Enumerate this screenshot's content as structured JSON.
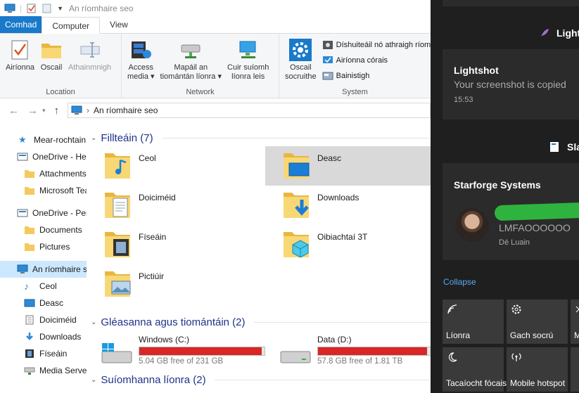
{
  "explorer": {
    "title": "An ríomhaire seo",
    "tabs": {
      "file": "Comhad",
      "computer": "Computer",
      "view": "View"
    },
    "ribbon": {
      "location": {
        "label": "Location",
        "properties": "Airíonna",
        "open": "Oscail",
        "rename": "Athainmnigh"
      },
      "network": {
        "label": "Network",
        "access_media_1": "Access",
        "access_media_2": "media",
        "map_drive_1": "Mapáil an",
        "map_drive_2": "tiomántán líonra",
        "add_location_1": "Cuir suíomh",
        "add_location_2": "líonra leis"
      },
      "system": {
        "label": "System",
        "open_settings_1": "Oscail",
        "open_settings_2": "socruithe",
        "uninstall": "Díshuiteáil nó athraigh ríomhchláir",
        "system_properties": "Airíonna córais",
        "manage": "Bainistigh"
      }
    },
    "address": {
      "path": "An ríomhaire seo"
    },
    "nav": [
      {
        "label": "Mear-rochtain",
        "icon": "star-icon"
      },
      {
        "label": "OneDrive - Heartbeat",
        "icon": "onedrive-icon"
      },
      {
        "label": "Attachments",
        "icon": "folder-icon"
      },
      {
        "label": "Microsoft Teams",
        "icon": "folder-icon"
      },
      {
        "label": "OneDrive - Personal",
        "icon": "onedrive-icon"
      },
      {
        "label": "Documents",
        "icon": "folder-icon"
      },
      {
        "label": "Pictures",
        "icon": "folder-icon"
      },
      {
        "label": "An ríomhaire seo",
        "icon": "computer-icon"
      },
      {
        "label": "Ceol",
        "icon": "music-icon"
      },
      {
        "label": "Deasc",
        "icon": "desktop-icon"
      },
      {
        "label": "Doiciméid",
        "icon": "document-icon"
      },
      {
        "label": "Downloads",
        "icon": "download-icon"
      },
      {
        "label": "Físeáin",
        "icon": "video-icon"
      },
      {
        "label": "Media Server",
        "icon": "network-drive-icon"
      }
    ],
    "folders_header": "Fillteáin (7)",
    "folders": [
      {
        "label": "Ceol",
        "icon": "music"
      },
      {
        "label": "Deasc",
        "icon": "desktop"
      },
      {
        "label": "Doiciméid",
        "icon": "document"
      },
      {
        "label": "Downloads",
        "icon": "download"
      },
      {
        "label": "Físeáin",
        "icon": "video"
      },
      {
        "label": "Oibiachtaí 3T",
        "icon": "3d"
      },
      {
        "label": "Pictiúir",
        "icon": "picture"
      }
    ],
    "drives_header": "Gléasanna agus tiomántáin (2)",
    "drives": [
      {
        "label": "Windows (C:)",
        "free": "5.04 GB free of 231 GB",
        "used_fraction": 0.978
      },
      {
        "label": "Data (D:)",
        "free": "57.8 GB free of 1.81 TB",
        "used_fraction": 0.969
      }
    ],
    "network_header": "Suíomhanna líonra (2)"
  },
  "panel": {
    "top_app": "Light",
    "lightshot": {
      "title": "Lightshot",
      "body": "Your screenshot is copied",
      "time": "15:53"
    },
    "slack_label": "Sla",
    "starforge": {
      "title": "Starforge Systems",
      "message": "LMFAOOOOOO",
      "day": "Dé Luain"
    },
    "collapse": "Collapse",
    "quick_actions": [
      {
        "label": "Líonra",
        "icon": "network-icon"
      },
      {
        "label": "Gach socrú",
        "icon": "gear-icon"
      },
      {
        "label": "M",
        "icon": "partial-icon"
      },
      {
        "label": "Tacaíocht fócais",
        "icon": "moon-icon"
      },
      {
        "label": "Mobile hotspot",
        "icon": "hotspot-icon"
      }
    ],
    "accent": "#1979ca",
    "redact_color": "#2fb33f"
  }
}
